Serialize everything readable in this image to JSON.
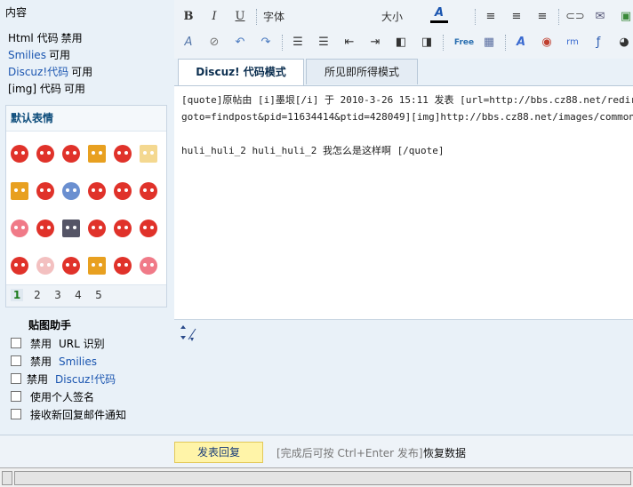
{
  "left": {
    "content_label": "内容",
    "permissions": [
      {
        "key": "Html 代码",
        "value": "禁用",
        "blue": false
      },
      {
        "key": "Smilies",
        "value": "可用",
        "blue": true
      },
      {
        "key": "Discuz!代码",
        "value": "可用",
        "blue": true
      },
      {
        "key": "[img] 代码",
        "value": "可用",
        "blue": false
      }
    ],
    "smilies": {
      "title": "默认表情",
      "pages": [
        "1",
        "2",
        "3",
        "4",
        "5"
      ],
      "active_page": "1"
    },
    "helper_title": "贴图助手",
    "options": [
      {
        "prefix": "禁用",
        "label": "URL 识别"
      },
      {
        "prefix": "禁用",
        "label": "Smilies"
      },
      {
        "prefix": "禁用",
        "label": "Discuz!代码"
      },
      {
        "prefix": "",
        "label": "使用个人签名"
      },
      {
        "prefix": "",
        "label": "接收新回复邮件通知"
      }
    ]
  },
  "toolbar": {
    "bold": "B",
    "italic": "I",
    "underline": "U",
    "font": "字体",
    "size": "大小",
    "color_letter": "A",
    "free": "Free",
    "icons": {
      "row1": [
        "bold-icon",
        "italic-icon",
        "underline-icon",
        "font-select",
        "size-select",
        "font-color-icon",
        "align-left-icon",
        "align-center-icon",
        "align-right-icon",
        "link-icon",
        "email-icon",
        "image-icon"
      ],
      "row2": [
        "remove-format-icon",
        "unlink-icon",
        "undo-icon",
        "redo-icon",
        "ordered-list-icon",
        "unordered-list-icon",
        "outdent-icon",
        "indent-icon",
        "float-left-icon",
        "float-right-icon",
        "free-icon",
        "table-icon",
        "text-effect-icon",
        "media-icon",
        "real-icon",
        "flash-icon",
        "qq-icon"
      ]
    }
  },
  "editor": {
    "tab_code": "Discuz! 代码模式",
    "tab_wysiwyg": "所见即所得模式",
    "text_line1": "[quote]原帖由 [i]墨垠[/i] 于 2010-3-26 15:11 发表 [url=http://bbs.cz88.net/redirect.php?",
    "text_line2": "goto=findpost&pid=11634414&ptid=428049][img]http://bbs.cz88.net/images/common/back.gif[/img][/url]",
    "text_line3": "",
    "text_line4": "huli_huli_2 huli_huli_2 我怎么是这样啊 [/quote]"
  },
  "bottom": {
    "submit_label": "发表回复",
    "hint": "[完成后可按 Ctrl+Enter 发布]",
    "restore": "恢复数据"
  }
}
